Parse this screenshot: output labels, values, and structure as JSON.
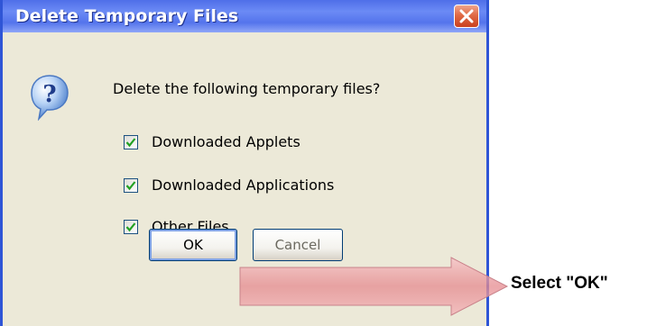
{
  "dialog": {
    "title": "Delete Temporary Files",
    "close_icon": "close-x-icon",
    "question_icon": "question-mark-bubble-icon",
    "prompt": "Delete the following temporary files?",
    "options": [
      {
        "label": "Downloaded Applets",
        "checked": true
      },
      {
        "label": "Downloaded Applications",
        "checked": true
      },
      {
        "label": "Other Files",
        "checked": true
      }
    ],
    "ok_label": "OK",
    "cancel_label": "Cancel"
  },
  "annotation": {
    "callout_text": "Select \"OK\"",
    "arrow_color": "#e58a8f"
  },
  "colors": {
    "titlebar": "#5474ec",
    "dialog_face": "#ece9d8",
    "close_button": "#e06a45",
    "checkmark": "#21a121"
  }
}
